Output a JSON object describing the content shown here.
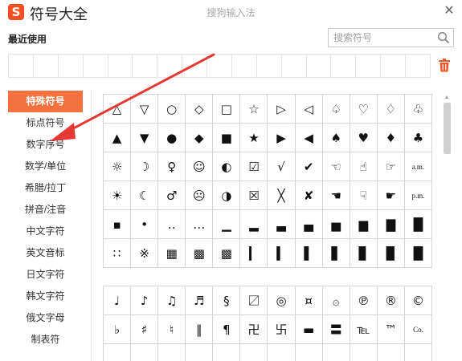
{
  "title_bar": {
    "logo_glyph": "S",
    "app_title": "符号大全",
    "ime_name": "搜狗输入法",
    "close_glyph": "✕"
  },
  "recent": {
    "label": "最近使用"
  },
  "search": {
    "placeholder": "搜索符号"
  },
  "categories": [
    {
      "label": "特殊符号",
      "active": true
    },
    {
      "label": "标点符号"
    },
    {
      "label": "数字序号"
    },
    {
      "label": "数学/单位"
    },
    {
      "label": "希腊/拉丁"
    },
    {
      "label": "拼音/注音"
    },
    {
      "label": "中文字符"
    },
    {
      "label": "英文音标"
    },
    {
      "label": "日文字符"
    },
    {
      "label": "韩文字符"
    },
    {
      "label": "俄文字母"
    },
    {
      "label": "制表符"
    }
  ],
  "symbols_main": [
    "△",
    "▽",
    "○",
    "◇",
    "□",
    "☆",
    "▷",
    "◁",
    "♤",
    "♡",
    "♢",
    "♧",
    "▲",
    "▼",
    "●",
    "◆",
    "■",
    "★",
    "▶",
    "◀",
    "♠",
    "♥",
    "♦",
    "♣",
    "☼",
    "☽",
    "♀",
    "☺",
    "◐",
    "☑",
    "√",
    "✔",
    "☜",
    "☝",
    "☞",
    "a.m.",
    "☀",
    "☾",
    "♂",
    "☹",
    "◑",
    "☒",
    "╳",
    "✘",
    "☚",
    "☟",
    "☛",
    "p.m.",
    "▪",
    "•",
    "‥",
    "…",
    "▁",
    "▂",
    "▃",
    "▄",
    "▅",
    "▆",
    "▇",
    "█",
    "∷",
    "※",
    "▦",
    "▩",
    "▩",
    "▎",
    "▍",
    "▌",
    "▋",
    "▊",
    "▉",
    "█"
  ],
  "symbols_music": [
    "♩",
    "♪",
    "♫",
    "♬",
    "§",
    "〼",
    "◎",
    "¤",
    "۞",
    "℗",
    "®",
    "©",
    "♭",
    "♯",
    "♮",
    "‖",
    "¶",
    "卍",
    "卐",
    "▬",
    "〓",
    "℡",
    "™",
    "Co.",
    "",
    "",
    "",
    "",
    "",
    "",
    "",
    "",
    "",
    "",
    "",
    ""
  ],
  "colors": {
    "accent": "#f4723e",
    "logo": "#f04e23",
    "arrow": "#e53935",
    "trash": "#e8592b"
  },
  "icons": {
    "search": "search-icon",
    "trash": "trash-icon",
    "close": "close-icon",
    "logo": "sogou-logo-icon"
  }
}
